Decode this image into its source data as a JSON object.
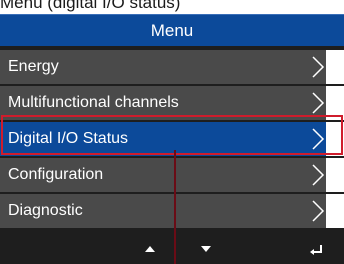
{
  "caption": "Menu (digital I/O status)",
  "header": {
    "title": "Menu"
  },
  "menu": {
    "items": [
      {
        "label": "Energy"
      },
      {
        "label": "Multifunctional channels"
      },
      {
        "label": "Digital I/O Status"
      },
      {
        "label": "Configuration"
      },
      {
        "label": "Diagnostic"
      }
    ],
    "selected_label": "Digital I/O Status"
  },
  "footer": {
    "buttons": [
      "up-arrow-icon",
      "down-arrow-icon",
      "enter-icon"
    ]
  },
  "colors": {
    "header_bg": "#0c4a9a",
    "item_bg": "#4a4a4a",
    "selected_bg": "#0c4a9a",
    "highlight_border": "#d01c2c",
    "pointer_line": "#6a0c16"
  }
}
